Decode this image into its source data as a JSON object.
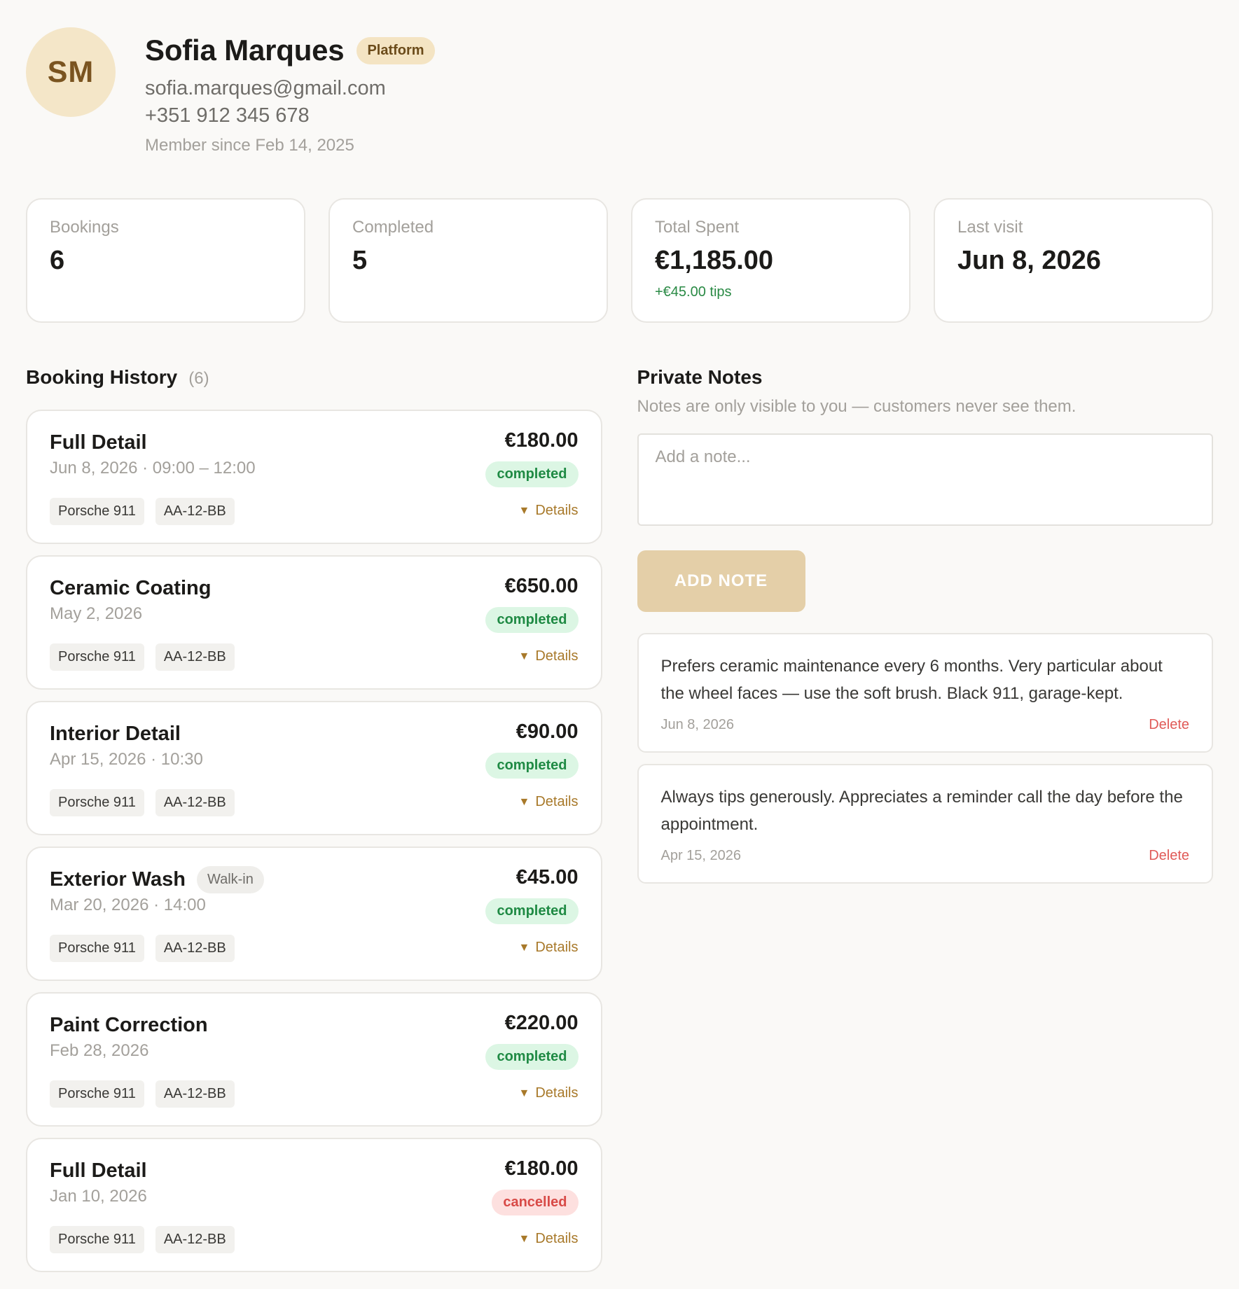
{
  "customer": {
    "initials": "SM",
    "name": "Sofia Marques",
    "badge": "Platform",
    "email": "sofia.marques@gmail.com",
    "phone": "+351 912 345 678",
    "member_since": "Member since Feb 14, 2025"
  },
  "stats": [
    {
      "label": "Bookings",
      "value": "6",
      "sub": ""
    },
    {
      "label": "Completed",
      "value": "5",
      "sub": ""
    },
    {
      "label": "Total Spent",
      "value": "€1,185.00",
      "sub": "+€45.00 tips"
    },
    {
      "label": "Last visit",
      "value": "Jun 8, 2026",
      "sub": ""
    }
  ],
  "history": {
    "title": "Booking History",
    "count": "(6)",
    "details_label": "Details",
    "bookings": [
      {
        "service": "Full Detail",
        "tag": "",
        "date": "Jun 8, 2026 · 09:00 – 12:00",
        "vehicle": "Porsche 911",
        "plate": "AA-12-BB",
        "price": "€180.00",
        "status": "completed"
      },
      {
        "service": "Ceramic Coating",
        "tag": "",
        "date": "May 2, 2026",
        "vehicle": "Porsche 911",
        "plate": "AA-12-BB",
        "price": "€650.00",
        "status": "completed"
      },
      {
        "service": "Interior Detail",
        "tag": "",
        "date": "Apr 15, 2026 · 10:30",
        "vehicle": "Porsche 911",
        "plate": "AA-12-BB",
        "price": "€90.00",
        "status": "completed"
      },
      {
        "service": "Exterior Wash",
        "tag": "Walk-in",
        "date": "Mar 20, 2026 · 14:00",
        "vehicle": "Porsche 911",
        "plate": "AA-12-BB",
        "price": "€45.00",
        "status": "completed"
      },
      {
        "service": "Paint Correction",
        "tag": "",
        "date": "Feb 28, 2026",
        "vehicle": "Porsche 911",
        "plate": "AA-12-BB",
        "price": "€220.00",
        "status": "completed"
      },
      {
        "service": "Full Detail",
        "tag": "",
        "date": "Jan 10, 2026",
        "vehicle": "Porsche 911",
        "plate": "AA-12-BB",
        "price": "€180.00",
        "status": "cancelled"
      }
    ]
  },
  "notes": {
    "title": "Private Notes",
    "subtitle": "Notes are only visible to you — customers never see them.",
    "placeholder": "Add a note...",
    "add_label": "ADD NOTE",
    "delete_label": "Delete",
    "items": [
      {
        "text": "Prefers ceramic maintenance every 6 months. Very particular about the wheel faces — use the soft brush. Black 911, garage-kept.",
        "date": "Jun 8, 2026"
      },
      {
        "text": "Always tips generously. Appreciates a reminder call the day before the appointment.",
        "date": "Apr 15, 2026"
      }
    ]
  },
  "colors": {
    "accent": "#a8792a",
    "completed": "#1f8a44",
    "cancelled": "#d84a47",
    "button": "#e4cfa8"
  }
}
